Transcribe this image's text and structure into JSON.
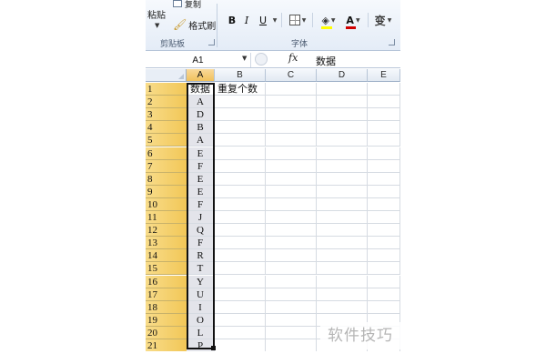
{
  "ribbon": {
    "clipboard": {
      "paste_label": "粘贴",
      "copy_label": "复制",
      "format_painter_label": "格式刷",
      "group_label": "剪贴板"
    },
    "font": {
      "bold": "B",
      "italic": "I",
      "underline": "U",
      "font_color_letter": "A",
      "wen_letter": "变",
      "group_label": "字体",
      "fill_color": "#ffff00",
      "font_color": "#d00000"
    }
  },
  "formula_bar": {
    "name_box": "A1",
    "fx_label": "fx",
    "value": "数据"
  },
  "sheet": {
    "columns": [
      "A",
      "B",
      "C",
      "D",
      "E"
    ],
    "selected_column": "A",
    "rows": [
      {
        "num": "1",
        "a": "数据",
        "b": "重复个数"
      },
      {
        "num": "2",
        "a": "A",
        "b": ""
      },
      {
        "num": "3",
        "a": "D",
        "b": ""
      },
      {
        "num": "4",
        "a": "B",
        "b": ""
      },
      {
        "num": "5",
        "a": "A",
        "b": ""
      },
      {
        "num": "6",
        "a": "E",
        "b": ""
      },
      {
        "num": "7",
        "a": "F",
        "b": ""
      },
      {
        "num": "8",
        "a": "E",
        "b": ""
      },
      {
        "num": "9",
        "a": "E",
        "b": ""
      },
      {
        "num": "10",
        "a": "F",
        "b": ""
      },
      {
        "num": "11",
        "a": "J",
        "b": ""
      },
      {
        "num": "12",
        "a": "Q",
        "b": ""
      },
      {
        "num": "13",
        "a": "F",
        "b": ""
      },
      {
        "num": "14",
        "a": "R",
        "b": ""
      },
      {
        "num": "15",
        "a": "T",
        "b": ""
      },
      {
        "num": "16",
        "a": "Y",
        "b": ""
      },
      {
        "num": "17",
        "a": "U",
        "b": ""
      },
      {
        "num": "18",
        "a": "I",
        "b": ""
      },
      {
        "num": "19",
        "a": "O",
        "b": ""
      },
      {
        "num": "20",
        "a": "L",
        "b": ""
      },
      {
        "num": "21",
        "a": "P",
        "b": ""
      }
    ],
    "header_highlight_color": "#f2c757",
    "selection_border_color": "#111111"
  },
  "watermark": "软件技巧"
}
